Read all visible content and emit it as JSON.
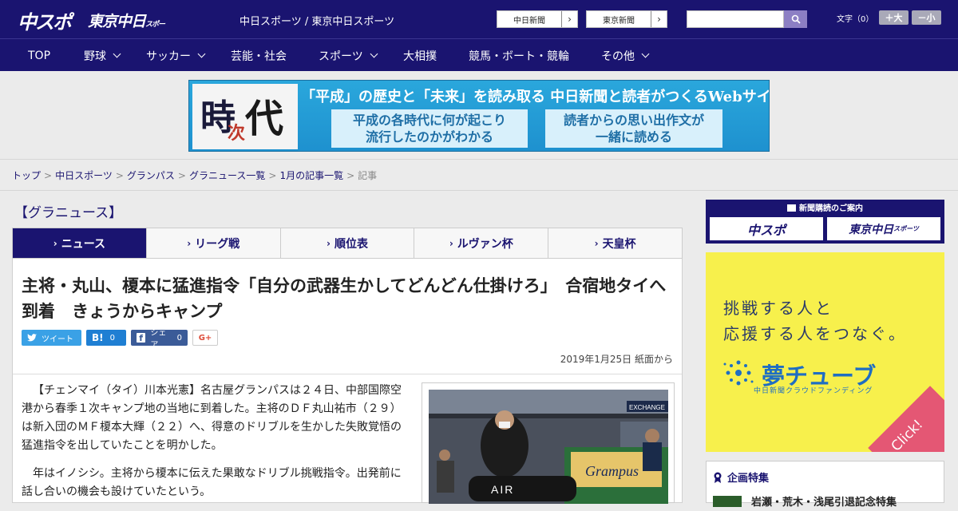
{
  "header": {
    "logo_chunichi_sports": "中スポ",
    "logo_tokyo_chunichi": "東京中日",
    "logo_tokyo_chunichi_small": "スポーツ",
    "site_links": "中日スポーツ / 東京中日スポーツ",
    "paper_links": [
      "中日新聞",
      "東京新聞"
    ],
    "search_placeholder": "",
    "font_size_label": "文字（0）",
    "font_size_buttons": [
      "＋大",
      "－小"
    ],
    "colors": {
      "navy": "#1a1470",
      "search_button": "#8c7fc4"
    }
  },
  "nav": {
    "items": [
      {
        "label": "TOP",
        "has_dropdown": false
      },
      {
        "label": "野球",
        "has_dropdown": true
      },
      {
        "label": "サッカー",
        "has_dropdown": true
      },
      {
        "label": "芸能・社会",
        "has_dropdown": false
      },
      {
        "label": "スポーツ",
        "has_dropdown": true
      },
      {
        "label": "大相撲",
        "has_dropdown": false
      },
      {
        "label": "競馬・ボート・競輪",
        "has_dropdown": false
      },
      {
        "label": "その他",
        "has_dropdown": true
      }
    ]
  },
  "banner": {
    "logo_chars": [
      "時",
      "次",
      "代"
    ],
    "headline": "「平成」の歴史と「未来」を読み取る 中日新聞と読者がつくるWebサイト",
    "boxes": [
      {
        "line1": "平成の各時代に何が起こり",
        "line2": "流行したのかがわかる"
      },
      {
        "line1": "読者からの思い出作文が",
        "line2": "一緒に読める"
      }
    ]
  },
  "breadcrumb": {
    "links": [
      "トップ",
      "中日スポーツ",
      "グランパス",
      "グラニュース一覧",
      "1月の記事一覧"
    ],
    "current": "記事",
    "separator": ">"
  },
  "section": {
    "title": "【グラニュース】"
  },
  "tabs": [
    {
      "label": "ニュース",
      "active": true
    },
    {
      "label": "リーグ戦",
      "active": false
    },
    {
      "label": "順位表",
      "active": false
    },
    {
      "label": "ルヴァン杯",
      "active": false
    },
    {
      "label": "天皇杯",
      "active": false
    }
  ],
  "article": {
    "headline": "主将・丸山、榎本に猛進指令「自分の武器生かしてどんどん仕掛けろ」　合宿地タイへ到着　きょうからキャンプ",
    "share": {
      "tweet_label": "ツイート",
      "hatena_label": "B!",
      "hatena_count": "0",
      "facebook_label": "シェア",
      "facebook_count": "0",
      "google_label": "G+"
    },
    "dateline": "2019年1月25日 紙面から",
    "paragraphs": [
      "【チェンマイ（タイ）川本光憲】名古屋グランパスは２４日、中部国際空港から春季１次キャンプ地の当地に到着した。主将のＤＦ丸山祐市（２９）は新入団のＭＦ榎本大輝（２２）へ、得意のドリブルを生かした失敗覚悟の猛進指令を出していたことを明かした。",
      "年はイノシシ。主将から榎本に伝えた果敢なドリブル挑戦指令。出発前に話し合いの機会も設けていたという。"
    ],
    "photo_texts": {
      "exchange_sign": "EXCHANGE",
      "bag_text": "AIR",
      "banner_text": "Grampus"
    }
  },
  "sidebar": {
    "subscription": {
      "heading": "新聞購読のご案内",
      "logos": [
        "中スポ",
        "東京中日"
      ],
      "logo2_small": "スポーツ"
    },
    "ad": {
      "line1": "挑戦する人と",
      "line2": "応援する人をつなぐ。",
      "brand": "夢チューブ",
      "sub": "中日新聞クラウドファンディング",
      "click": "Click!",
      "colors": {
        "background": "#f7f04c",
        "brand": "#1f6ec2",
        "click": "#e45774"
      }
    },
    "feature": {
      "title": "企画特集",
      "item_text": "岩瀬・荒木・浅尾引退記念特集"
    }
  }
}
